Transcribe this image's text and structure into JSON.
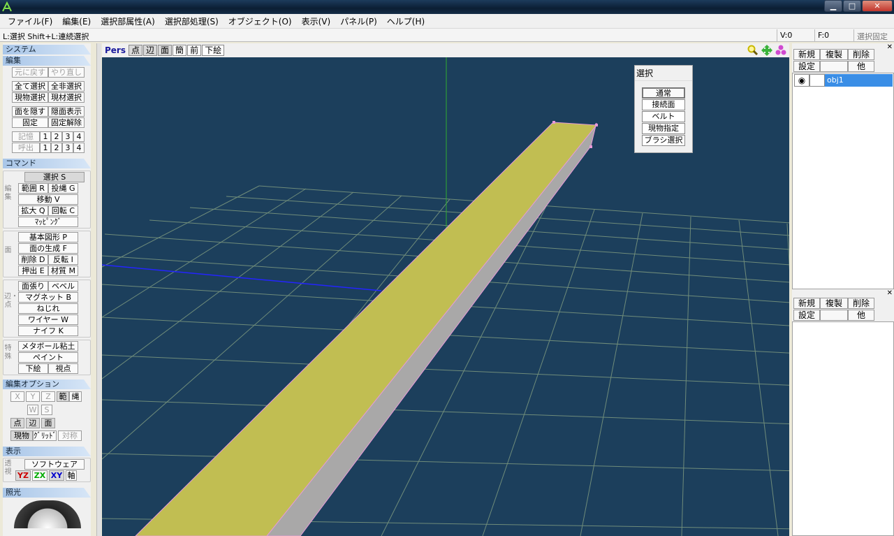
{
  "window": {
    "min_label": "▁",
    "max_label": "□",
    "close_label": "✕"
  },
  "menu": [
    "ファイル(F)",
    "編集(E)",
    "選択部属性(A)",
    "選択部処理(S)",
    "オブジェクト(O)",
    "表示(V)",
    "パネル(P)",
    "ヘルプ(H)"
  ],
  "status": {
    "message": "L:選択  Shift+L:連続選択",
    "vertex_count": "V:0",
    "face_count": "F:0",
    "select_lock": "選択固定"
  },
  "left": {
    "system": "システム",
    "edit": "編集",
    "undo": "元に戻す",
    "redo": "やり直し",
    "select_all": "全て選択",
    "deselect_all": "全非選択",
    "select_current_obj": "現物選択",
    "select_current_mat": "現材選択",
    "hide_face": "面を隠す",
    "show_hidden": "隠面表示",
    "fix": "固定",
    "unfix": "固定解除",
    "memory": "記憶",
    "recall": "呼出",
    "slots": [
      "1",
      "2",
      "3",
      "4"
    ],
    "command": "コマンド",
    "edit_group": "編集",
    "select_s": "選択 S",
    "range_r": "範囲 R",
    "lasso_g": "投縄 G",
    "move_v": "移動 V",
    "scale_q": "拡大 Q",
    "rotate_c": "回転 C",
    "mapping": "ﾏｯﾋﾟﾝｸﾞ",
    "face_group": "面",
    "primitive_p": "基本図形 P",
    "face_gen_f": "面の生成 F",
    "delete_d": "削除 D",
    "flip_i": "反転 I",
    "extrude_e": "押出 E",
    "material_m": "材質 M",
    "edge_group": "辺・点",
    "face_cut": "面張り",
    "bevel": "ベベル",
    "magnet_b": "マグネット B",
    "twist": "ねじれ",
    "wire_w": "ワイヤー W",
    "knife_k": "ナイフ K",
    "special_group": "特殊",
    "metaball": "メタボール粘土",
    "paint": "ペイント",
    "underlay": "下絵",
    "viewpoint": "視点",
    "edit_option": "編集オプション",
    "x": "X",
    "y": "Y",
    "z": "Z",
    "range": "範",
    "lasso": "縄",
    "w": "W",
    "s": "S",
    "point": "点",
    "edge": "辺",
    "face": "面",
    "current_obj": "現物",
    "grid": "ｸﾞﾘｯﾄﾞ",
    "symmetry": "対称",
    "display": "表示",
    "persp_group": "透視",
    "software": "ソフトウェア",
    "yz": "YZ",
    "zx": "ZX",
    "xy": "XY",
    "axis": "軸",
    "lighting": "照光"
  },
  "viewtb": {
    "pers": "Pers",
    "buttons": [
      "点",
      "辺",
      "面",
      "簡",
      "前",
      "下絵"
    ]
  },
  "select_panel": {
    "title": "選択",
    "buttons": [
      "通常",
      "接続面",
      "ベルト",
      "現物指定",
      "ブラシ選択"
    ]
  },
  "object_panel": {
    "new": "新規",
    "copy": "複製",
    "delete": "削除",
    "settings": "設定",
    "other": "他",
    "objects": [
      {
        "name": "obj1"
      }
    ]
  },
  "material_panel": {
    "new": "新規",
    "copy": "複製",
    "delete": "削除",
    "settings": "設定",
    "other": "他"
  },
  "colors": {
    "viewport_bg": "#1c3f5c",
    "grid": "#6f8c7a",
    "beam_top": "#c1be52",
    "beam_side": "#a9a8a8",
    "selected": "#3a8ee6"
  }
}
